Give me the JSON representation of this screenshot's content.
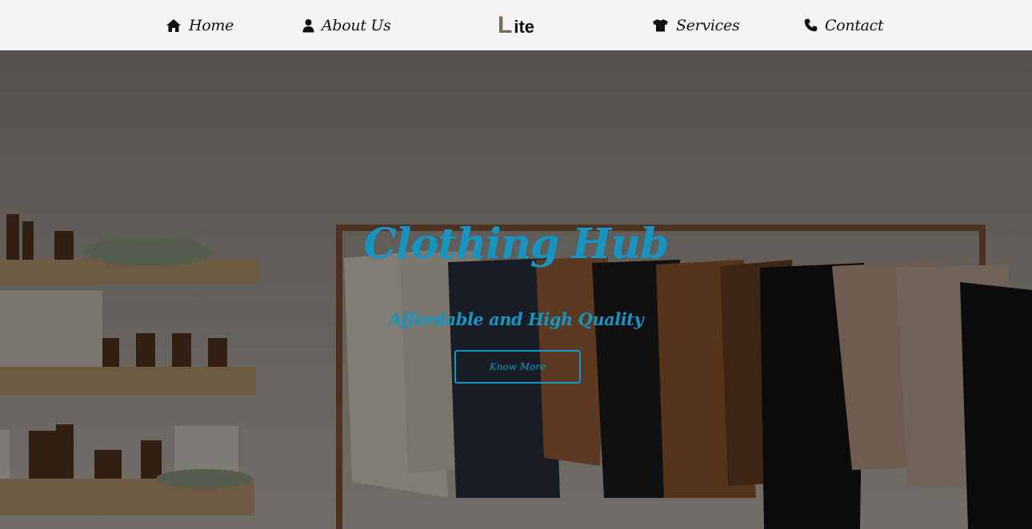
{
  "nav": {
    "items": [
      {
        "label": "Home",
        "icon": "home-icon"
      },
      {
        "label": "About Us",
        "icon": "user-icon"
      },
      {
        "label": "Services",
        "icon": "tshirt-icon"
      },
      {
        "label": "Contact",
        "icon": "phone-icon"
      }
    ],
    "logo": {
      "first": "L",
      "rest": "ite"
    }
  },
  "hero": {
    "title": "Clothing Hub",
    "subtitle": "Affordable and High Quality",
    "button_label": "Know More"
  },
  "colors": {
    "accent": "#1596c2",
    "nav_background": "#f4f4f4",
    "logo_first_letter": "#7a6858"
  }
}
